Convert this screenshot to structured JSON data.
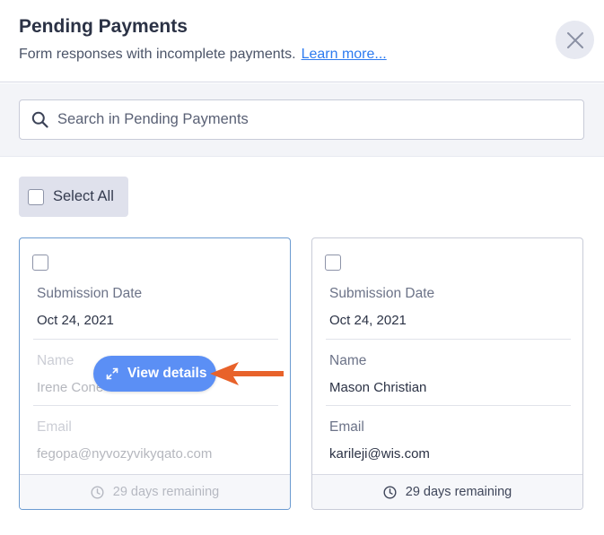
{
  "header": {
    "title": "Pending Payments",
    "subtitle": "Form responses with incomplete payments.",
    "learn_more": "Learn more..."
  },
  "search": {
    "placeholder": "Search in Pending Payments",
    "value": ""
  },
  "select_all": {
    "label": "Select All"
  },
  "cards": [
    {
      "submission_label": "Submission Date",
      "submission_value": "Oct 24, 2021",
      "name_label": "Name",
      "name_value": "Irene Cone",
      "email_label": "Email",
      "email_value": "fegopa@nyvozyvikyqato.com",
      "remaining": "29 days remaining"
    },
    {
      "submission_label": "Submission Date",
      "submission_value": "Oct 24, 2021",
      "name_label": "Name",
      "name_value": "Mason Christian",
      "email_label": "Email",
      "email_value": "karileji@wis.com",
      "remaining": "29 days remaining"
    }
  ],
  "view_details": {
    "label": "View details"
  },
  "icons": {
    "close": "close-icon",
    "search": "search-icon",
    "clock": "clock-icon",
    "expand": "expand-icon",
    "arrow": "arrow-left-icon"
  },
  "colors": {
    "accent": "#5b8ff5",
    "link": "#2d7bf0",
    "arrow": "#e8622a"
  }
}
